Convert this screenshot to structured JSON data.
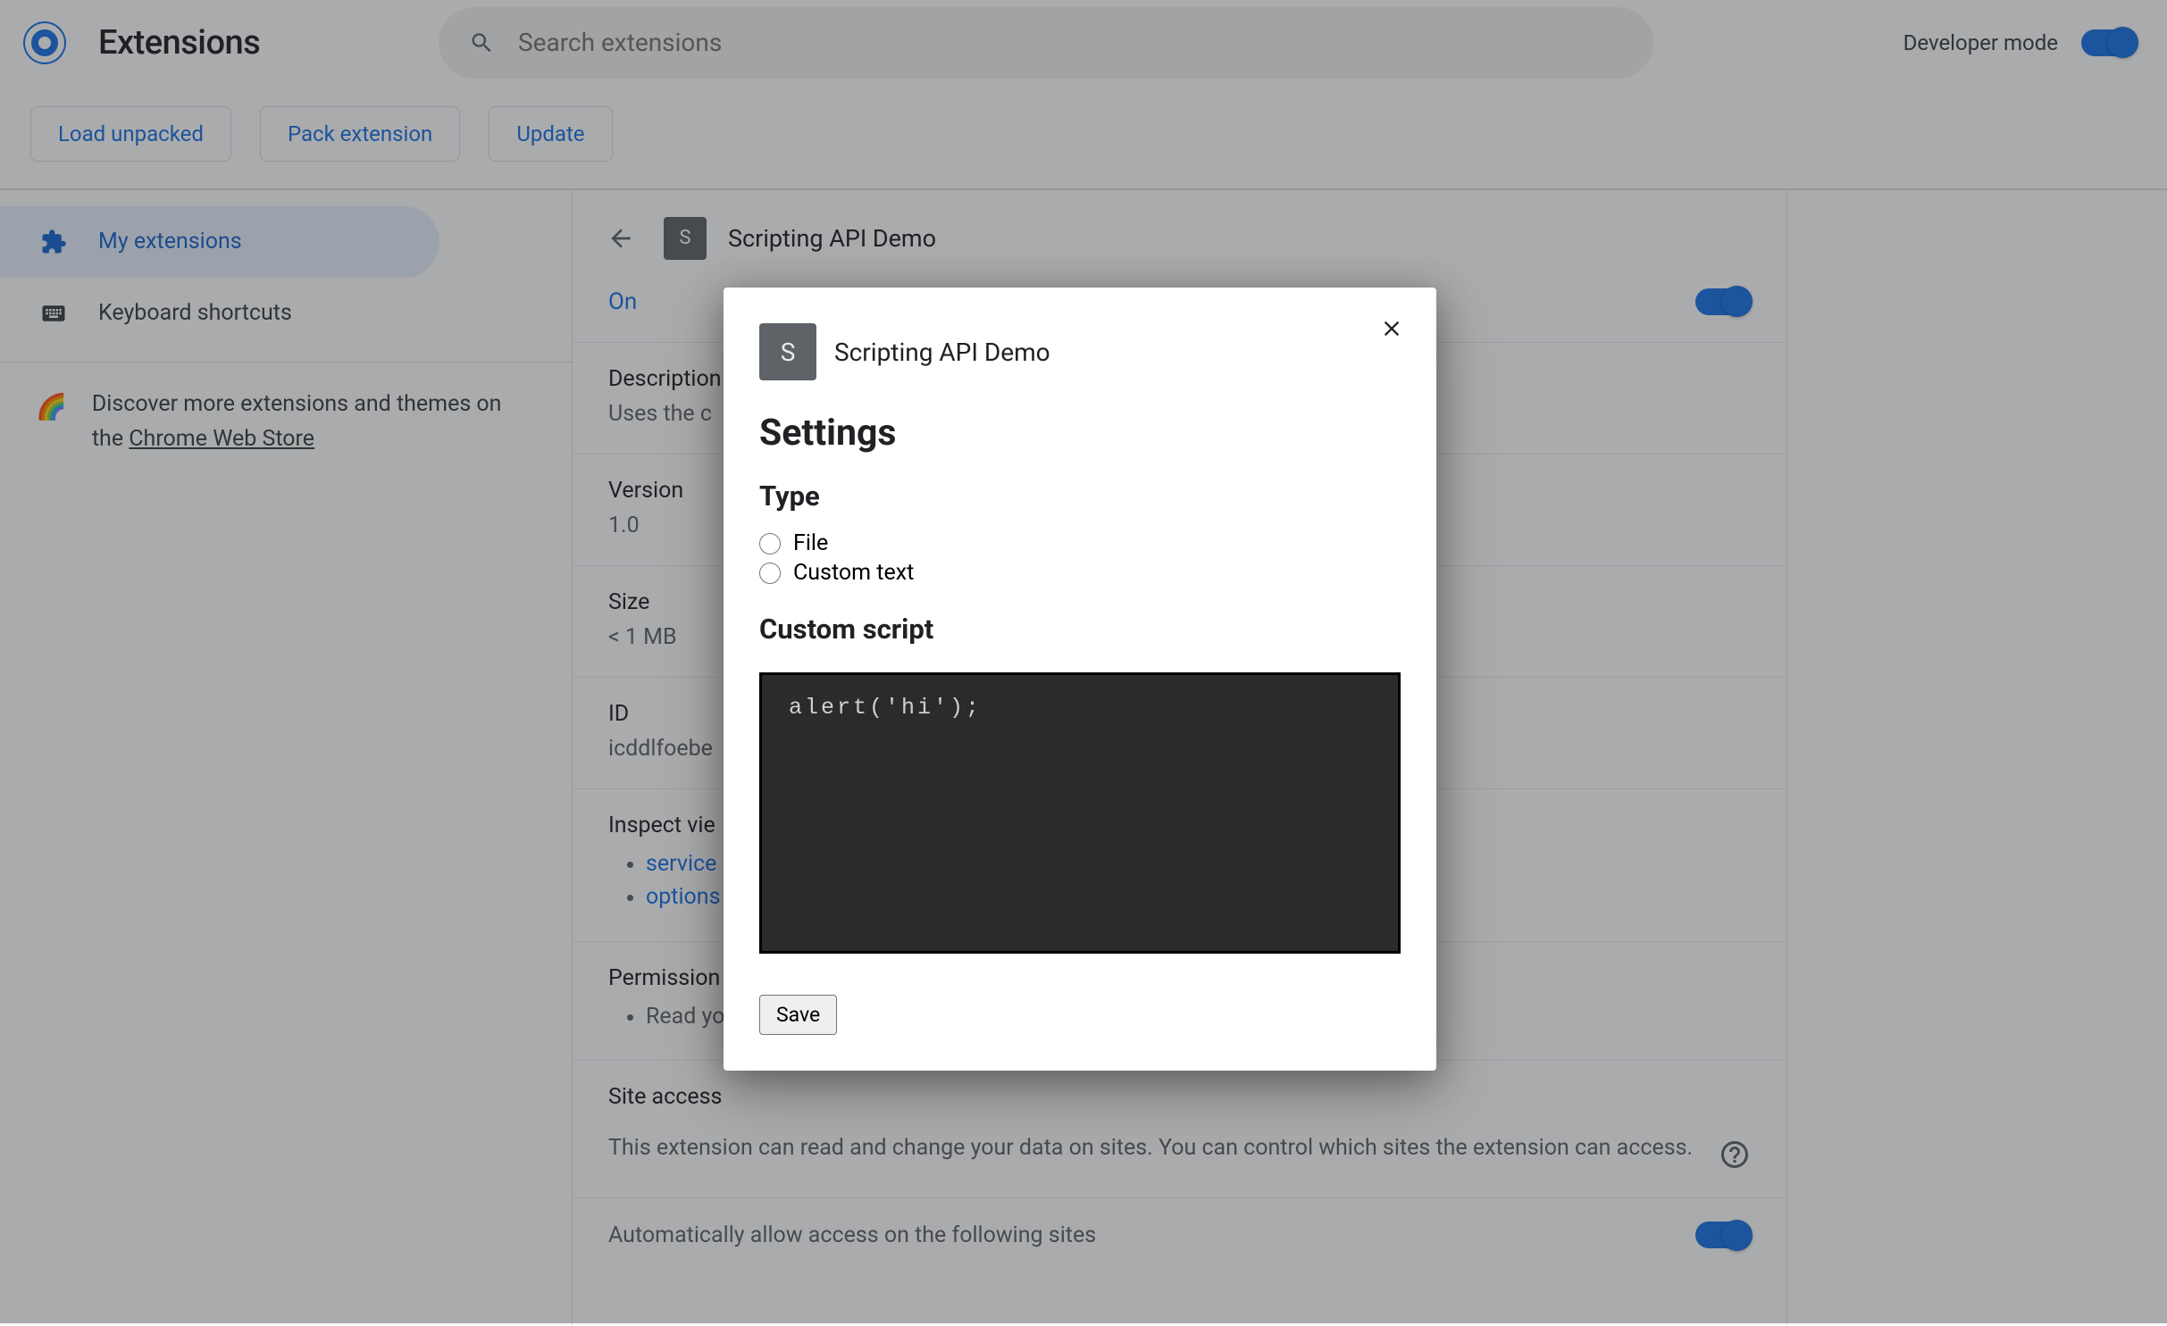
{
  "header": {
    "title": "Extensions",
    "search_placeholder": "Search extensions",
    "dev_mode_label": "Developer mode"
  },
  "actions": {
    "load_unpacked": "Load unpacked",
    "pack_extension": "Pack extension",
    "update": "Update"
  },
  "sidebar": {
    "items": [
      {
        "label": "My extensions"
      },
      {
        "label": "Keyboard shortcuts"
      }
    ],
    "discover_prefix": "Discover more extensions and themes on the ",
    "discover_link": "Chrome Web Store"
  },
  "detail": {
    "name": "Scripting API Demo",
    "badge": "S",
    "on_label": "On",
    "desc_label": "Description",
    "desc_value": "Uses the c",
    "version_label": "Version",
    "version_value": "1.0",
    "size_label": "Size",
    "size_value": "< 1 MB",
    "id_label": "ID",
    "id_value": "icddlfoebe",
    "inspect_label": "Inspect vie",
    "inspect_links": [
      "service",
      "options"
    ],
    "perm_label": "Permission",
    "perm_items": [
      "Read yo"
    ],
    "site_label": "Site access",
    "site_text": "This extension can read and change your data on sites. You can control which sites the extension can access.",
    "auto_allow": "Automatically allow access on the following sites"
  },
  "dialog": {
    "badge": "S",
    "ext_name": "Scripting API Demo",
    "heading": "Settings",
    "type_heading": "Type",
    "type_opts": [
      "File",
      "Custom text"
    ],
    "custom_heading": "Custom script",
    "code": "alert('hi');",
    "save": "Save"
  }
}
